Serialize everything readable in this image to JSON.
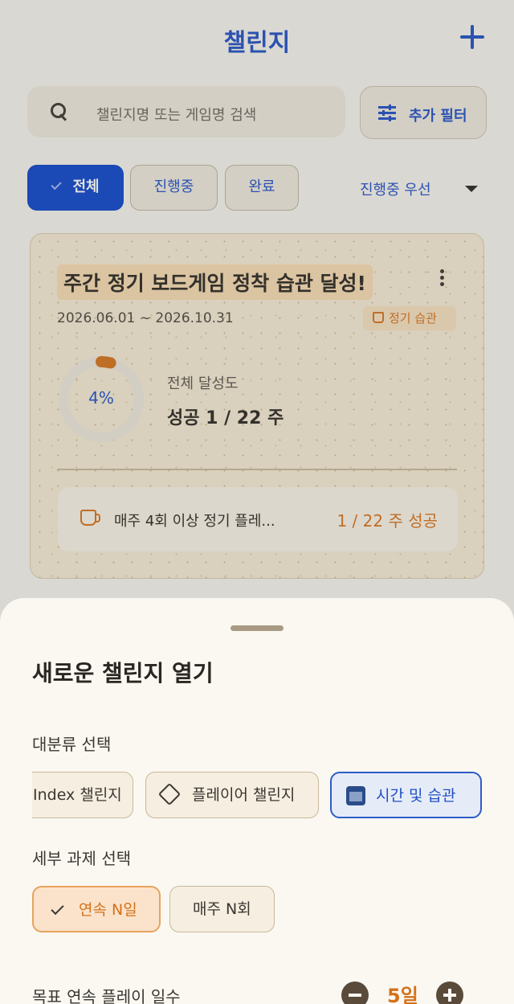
{
  "header": {
    "title": "챌린지",
    "add_icon": "plus-icon"
  },
  "search": {
    "placeholder": "챌린지명 또는 게임명 검색",
    "icon": "search-icon"
  },
  "filter_button": {
    "label": "추가 필터",
    "icon": "sliders-icon"
  },
  "status_tabs": [
    {
      "label": "전체",
      "selected": true
    },
    {
      "label": "진행중",
      "selected": false
    },
    {
      "label": "완료",
      "selected": false
    }
  ],
  "sort": {
    "label": "진행중 우선",
    "icon": "caret-down-icon"
  },
  "challenge_card": {
    "title": "주간 정기 보드게임 정착 습관 달성!",
    "date_range": "2026.06.01 ~ 2026.10.31",
    "tag": "정기 습관",
    "progress_percent_label": "4%",
    "progress_fraction": 0.04,
    "progress_label": "전체 달성도",
    "progress_value": "성공 1 / 22 주",
    "sub_task_label": "매주 4회 이상 정기 플레...",
    "sub_task_status": "1 / 22 주 성공",
    "colors": {
      "accent": "#d4711a",
      "primary": "#1f4fc4"
    }
  },
  "sheet": {
    "title": "새로운 챌린지 열기",
    "category_label": "대분류 선택",
    "categories": [
      {
        "label": "Index 챌린지",
        "selected": false
      },
      {
        "label": "플레이어 챌린지",
        "selected": false,
        "icon": "handshake-icon"
      },
      {
        "label": "시간 및 습관",
        "selected": true,
        "icon": "calendar-icon"
      }
    ],
    "task_label": "세부 과제 선택",
    "tasks": [
      {
        "label": "연속 N일",
        "selected": true
      },
      {
        "label": "매주 N회",
        "selected": false
      }
    ],
    "goal_label": "목표 연속 플레이 일수",
    "goal_value": "5일"
  }
}
